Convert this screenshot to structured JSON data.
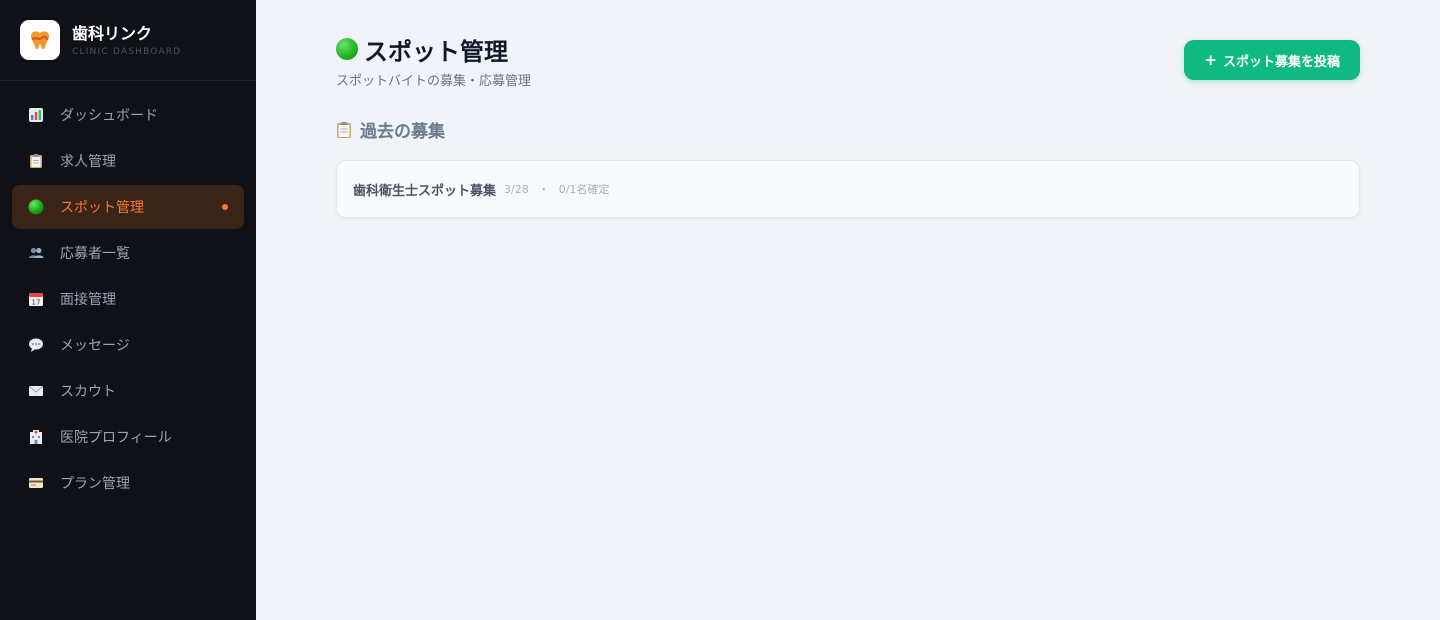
{
  "brand": {
    "name": "歯科リンク",
    "subtitle": "CLINIC DASHBOARD"
  },
  "sidebar": {
    "items": [
      {
        "label": "ダッシュボード",
        "icon": "bar-chart-icon",
        "active": false
      },
      {
        "label": "求人管理",
        "icon": "clipboard-icon",
        "active": false
      },
      {
        "label": "スポット管理",
        "icon": "green-circle-icon",
        "active": true
      },
      {
        "label": "応募者一覧",
        "icon": "people-icon",
        "active": false
      },
      {
        "label": "面接管理",
        "icon": "calendar-icon",
        "active": false
      },
      {
        "label": "メッセージ",
        "icon": "speech-bubble-icon",
        "active": false
      },
      {
        "label": "スカウト",
        "icon": "envelope-icon",
        "active": false
      },
      {
        "label": "医院プロフィール",
        "icon": "hospital-icon",
        "active": false
      },
      {
        "label": "プラン管理",
        "icon": "credit-card-icon",
        "active": false
      }
    ]
  },
  "header": {
    "title": "スポット管理",
    "subtitle": "スポットバイトの募集・応募管理",
    "post_button_label": "スポット募集を投稿",
    "post_button_icon": "+"
  },
  "section": {
    "title": "過去の募集"
  },
  "past_posts": [
    {
      "title": "歯科衛生士スポット募集",
      "date": "3/28",
      "separator": "・",
      "status": "0/1名確定"
    }
  ],
  "colors": {
    "sidebar_bg": "#0f1118",
    "accent_orange": "#f47b35",
    "primary_green": "#10b981",
    "main_bg": "#f0f3f7"
  }
}
